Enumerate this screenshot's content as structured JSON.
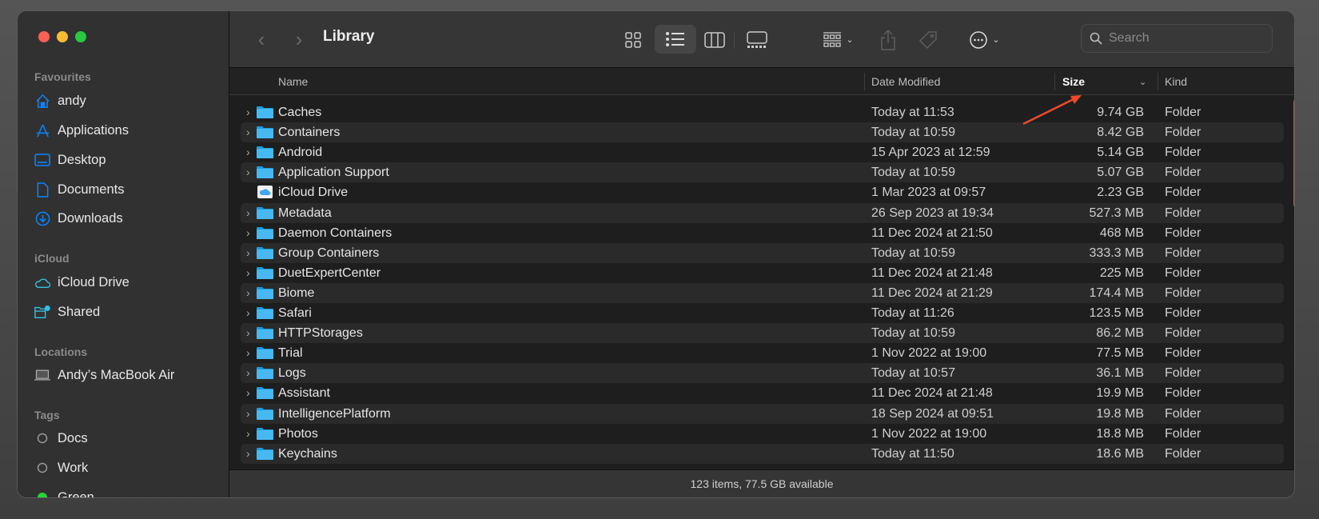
{
  "window": {
    "title": "Library",
    "status": "123 items, 77.5 GB available"
  },
  "search": {
    "placeholder": "Search"
  },
  "sidebar": {
    "sections": [
      {
        "label": "Favourites"
      },
      {
        "label": "iCloud"
      },
      {
        "label": "Locations"
      },
      {
        "label": "Tags"
      }
    ],
    "items": [
      {
        "label": "andy",
        "icon": "home-icon"
      },
      {
        "label": "Applications",
        "icon": "applications-icon"
      },
      {
        "label": "Desktop",
        "icon": "desktop-icon"
      },
      {
        "label": "Documents",
        "icon": "document-icon"
      },
      {
        "label": "Downloads",
        "icon": "download-icon"
      },
      {
        "label": "iCloud Drive",
        "icon": "cloud-icon"
      },
      {
        "label": "Shared",
        "icon": "shared-folder-icon"
      },
      {
        "label": "Andy’s MacBook Air",
        "icon": "laptop-icon"
      },
      {
        "label": "Docs",
        "icon": "tag-circle-icon"
      },
      {
        "label": "Work",
        "icon": "tag-circle-icon"
      },
      {
        "label": "Green",
        "icon": "tag-green-icon"
      }
    ]
  },
  "columns": {
    "name": "Name",
    "date": "Date Modified",
    "size": "Size",
    "kind": "Kind"
  },
  "colors": {
    "accent": "#0a84ff",
    "folder": "#3fb4f0",
    "highlight": "#ee4a2b"
  },
  "files": [
    {
      "name": "Caches",
      "date": "Today at 11:53",
      "size": "9.74 GB",
      "kind": "Folder"
    },
    {
      "name": "Containers",
      "date": "Today at 10:59",
      "size": "8.42 GB",
      "kind": "Folder"
    },
    {
      "name": "Android",
      "date": "15 Apr 2023 at 12:59",
      "size": "5.14 GB",
      "kind": "Folder"
    },
    {
      "name": "Application Support",
      "date": "Today at 10:59",
      "size": "5.07 GB",
      "kind": "Folder"
    },
    {
      "name": "iCloud Drive",
      "date": "1 Mar 2023 at 09:57",
      "size": "2.23 GB",
      "kind": "Folder"
    },
    {
      "name": "Metadata",
      "date": "26 Sep 2023 at 19:34",
      "size": "527.3 MB",
      "kind": "Folder"
    },
    {
      "name": "Daemon Containers",
      "date": "11 Dec 2024 at 21:50",
      "size": "468 MB",
      "kind": "Folder"
    },
    {
      "name": "Group Containers",
      "date": "Today at 10:59",
      "size": "333.3 MB",
      "kind": "Folder"
    },
    {
      "name": "DuetExpertCenter",
      "date": "11 Dec 2024 at 21:48",
      "size": "225 MB",
      "kind": "Folder"
    },
    {
      "name": "Biome",
      "date": "11 Dec 2024 at 21:29",
      "size": "174.4 MB",
      "kind": "Folder"
    },
    {
      "name": "Safari",
      "date": "Today at 11:26",
      "size": "123.5 MB",
      "kind": "Folder"
    },
    {
      "name": "HTTPStorages",
      "date": "Today at 10:59",
      "size": "86.2 MB",
      "kind": "Folder"
    },
    {
      "name": "Trial",
      "date": "1 Nov 2022 at 19:00",
      "size": "77.5 MB",
      "kind": "Folder"
    },
    {
      "name": "Logs",
      "date": "Today at 10:57",
      "size": "36.1 MB",
      "kind": "Folder"
    },
    {
      "name": "Assistant",
      "date": "11 Dec 2024 at 21:48",
      "size": "19.9 MB",
      "kind": "Folder"
    },
    {
      "name": "IntelligencePlatform",
      "date": "18 Sep 2024 at 09:51",
      "size": "19.8 MB",
      "kind": "Folder"
    },
    {
      "name": "Photos",
      "date": "1 Nov 2022 at 19:00",
      "size": "18.8 MB",
      "kind": "Folder"
    },
    {
      "name": "Keychains",
      "date": "Today at 11:50",
      "size": "18.6 MB",
      "kind": "Folder"
    }
  ]
}
